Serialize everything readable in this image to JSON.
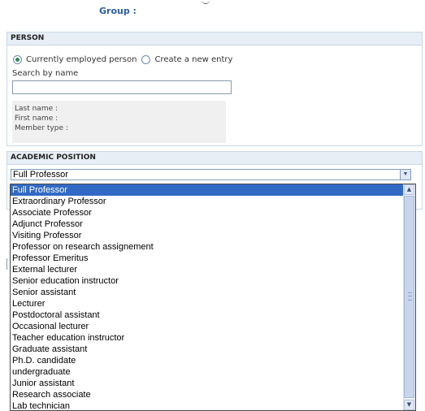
{
  "header": {
    "group_label": "Group :"
  },
  "person": {
    "section_title": "PERSON",
    "radio_options": [
      {
        "label": "Currently employed person",
        "checked": true
      },
      {
        "label": "Create a new entry",
        "checked": false
      }
    ],
    "search_label": "Search by name",
    "search_value": "",
    "info": {
      "last_name": "Last name :",
      "first_name": "First name :",
      "member_type": "Member type :"
    }
  },
  "academic": {
    "section_title": "ACADEMIC POSITION",
    "selected": "Full Professor",
    "options": [
      "Full Professor",
      "Extraordinary Professor",
      "Associate Professor",
      "Adjunct Professor",
      "Visiting Professor",
      "Professor on research assignement",
      "Professor Emeritus",
      "External lecturer",
      "Senior education instructor",
      "Senior assistant",
      "Lecturer",
      "Postdoctoral assistant",
      "Occasional lecturer",
      "Teacher education instructor",
      "Graduate assistant",
      "Ph.D. candidate",
      "undergraduate",
      "Junior assistant",
      "Research associate",
      "Lab technician"
    ],
    "highlighted_index": 0
  },
  "icons": {
    "dropdown_arrow": "chevron-down-icon",
    "scroll_up": "chevron-up-icon",
    "scroll_down": "chevron-down-icon"
  },
  "colors": {
    "selection": "#316ac5",
    "header_bg": "#e7eef6",
    "group_label": "#2a5d9f"
  }
}
